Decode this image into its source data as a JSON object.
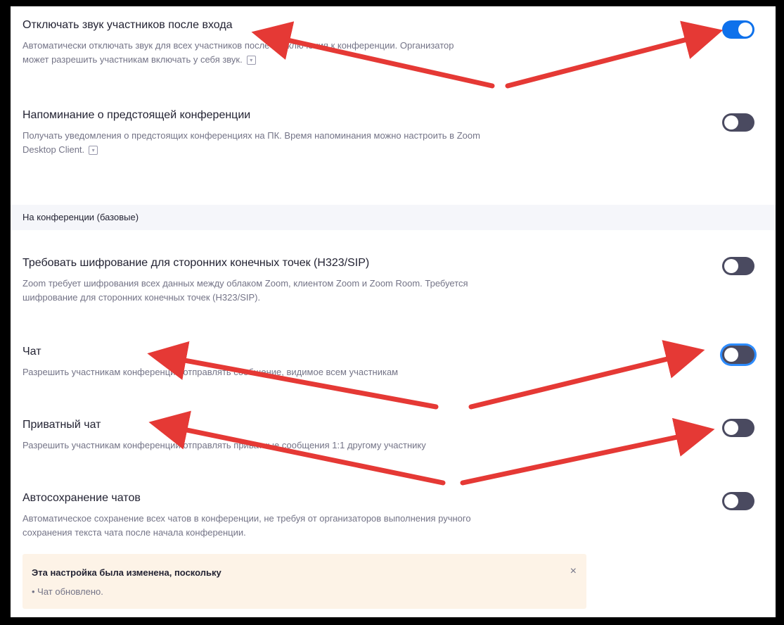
{
  "settings": [
    {
      "title": "Отключать звук участников после входа",
      "desc_line1": "Автоматически отключать звук для всех участников после подключения к конференции. Организатор",
      "desc_line2": "может разрешить участникам включать у себя звук.",
      "info_icon": true,
      "enabled": true
    },
    {
      "title": "Напоминание о предстоящей конференции",
      "desc_line1": "Получать уведомления о предстоящих конференциях на ПК. Время напоминания можно настроить в Zoom",
      "desc_line2": "Desktop Client.",
      "info_icon": true,
      "enabled": false
    },
    {
      "title": "Требовать шифрование для сторонних конечных точек (H323/SIP)",
      "desc_line1": "Zoom требует шифрования всех данных между облаком Zoom, клиентом Zoom и Zoom Room. Требуется",
      "desc_line2": "шифрование для сторонних конечных точек (H323/SIP).",
      "enabled": false
    },
    {
      "title": "Чат",
      "desc_line1": "Разрешить участникам конференции отправлять сообщение, видимое всем участникам",
      "enabled": false
    },
    {
      "title": "Приватный чат",
      "desc_line1": "Разрешить участникам конференции отправлять приватные сообщения 1:1 другому участнику",
      "enabled": false
    },
    {
      "title": "Автосохранение чатов",
      "desc_line1": "Автоматическое сохранение всех чатов в конференции, не требуя от организаторов выполнения ручного",
      "desc_line2": "сохранения текста чата после начала конференции.",
      "enabled": false
    }
  ],
  "section_header": "На конференции (базовые)",
  "notice": {
    "title": "Эта настройка была изменена, поскольку",
    "item": "• Чат обновлено.",
    "close": "×"
  },
  "colors": {
    "toggle_on": "#0e71eb",
    "toggle_off": "#4a4a60",
    "arrow": "#e53935",
    "notice_bg": "#fdf3e7"
  },
  "icons": {
    "info": "info-icon",
    "close": "close-icon"
  }
}
